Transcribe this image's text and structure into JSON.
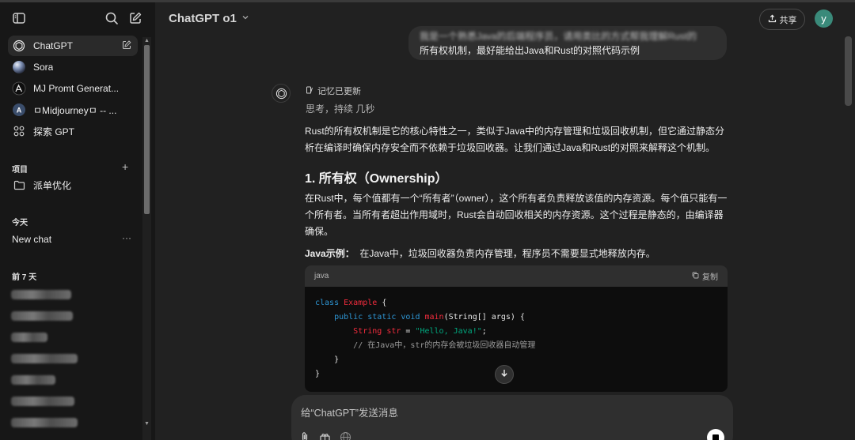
{
  "sidebar": {
    "items": [
      {
        "label": "ChatGPT",
        "icon": "openai-logo-icon",
        "active": true
      },
      {
        "label": "Sora",
        "icon": "sora-icon"
      },
      {
        "label": "MJ Promt Generat...",
        "icon": "mj-gpt-icon"
      },
      {
        "label": "ㅁMidjourneyㅁ -- ...",
        "icon": "midjourney-gpt-icon"
      },
      {
        "label": "探索 GPT",
        "icon": "explore-grid-icon"
      }
    ],
    "projects_heading": "项目",
    "project_item": "派单优化",
    "today_heading": "今天",
    "today_chat": "New chat",
    "today_chat_more": "···",
    "prev7_heading": "前 7 天"
  },
  "header": {
    "model_title": "ChatGPT o1",
    "share_label": "共享",
    "avatar_letter": "y"
  },
  "conversation": {
    "user_message_line1": "我是一个熟悉Java的后端程序员，请用类比的方式帮我理解Rust的",
    "user_message_line2": "所有权机制，最好能给出Java和Rust的对照代码示例",
    "memory_label": "记忆已更新",
    "thinking_label": "思考，持续 几秒",
    "intro_para": "Rust的所有权机制是它的核心特性之一，类似于Java中的内存管理和垃圾回收机制，但它通过静态分析在编译时确保内存安全而不依赖于垃圾回收器。让我们通过Java和Rust的对照来解释这个机制。",
    "heading": "1. 所有权（Ownership）",
    "ownership_para": "在Rust中，每个值都有一个“所有者”（owner），这个所有者负责释放该值的内存资源。每个值只能有一个所有者。当所有者超出作用域时，Rust会自动回收相关的内存资源。这个过程是静态的，由编译器确保。",
    "java_example_label": "Java示例：",
    "java_example_text": "在Java中，垃圾回收器负责内存管理，程序员不需要显式地释放内存。",
    "code": {
      "language": "java",
      "copy_label": "复制",
      "line1_kw": "class",
      "line1_cls": "Example",
      "line1_rest": " {",
      "line2_kw": "public static void",
      "line2_fn": "main",
      "line2_rest": "(String[] args) {",
      "line3_type": "String",
      "line3_var": "str",
      "line3_eq": " = ",
      "line3_str": "\"Hello, Java!\"",
      "line3_end": ";",
      "line4_cmt": "// 在Java中，str的内存会被垃圾回收器自动管理",
      "line5": "}",
      "line6": "}"
    }
  },
  "composer": {
    "placeholder": "给“ChatGPT”发送消息"
  }
}
